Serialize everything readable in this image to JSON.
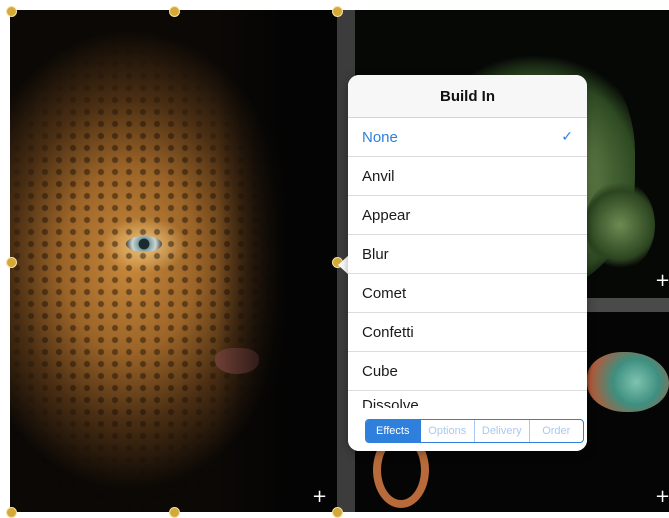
{
  "popover": {
    "title": "Build In",
    "items": [
      {
        "label": "None",
        "selected": true
      },
      {
        "label": "Anvil",
        "selected": false
      },
      {
        "label": "Appear",
        "selected": false
      },
      {
        "label": "Blur",
        "selected": false
      },
      {
        "label": "Comet",
        "selected": false
      },
      {
        "label": "Confetti",
        "selected": false
      },
      {
        "label": "Cube",
        "selected": false
      },
      {
        "label": "Dissolve",
        "selected": false
      }
    ],
    "check_glyph": "✓",
    "tabs": [
      {
        "label": "Effects",
        "active": true
      },
      {
        "label": "Options",
        "active": false
      },
      {
        "label": "Delivery",
        "active": false
      },
      {
        "label": "Order",
        "active": false
      }
    ]
  },
  "canvas": {
    "add_glyph": "+"
  },
  "colors": {
    "accent": "#2f7fdc",
    "handle": "#d4a93a"
  }
}
